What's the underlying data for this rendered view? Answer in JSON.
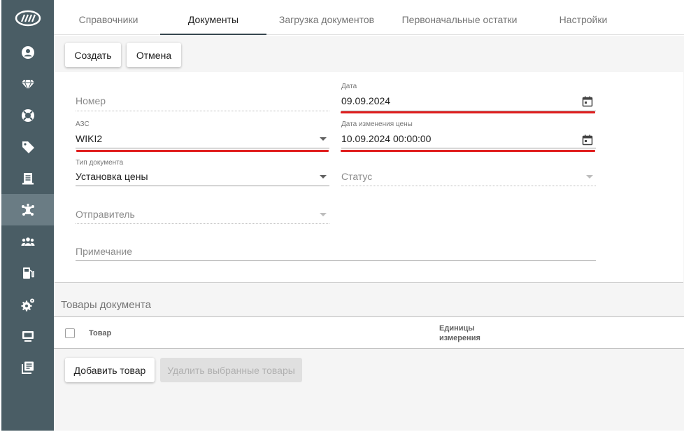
{
  "sidebar": {
    "logo_icon": "logo-ellipse-icon",
    "items": [
      {
        "icon": "user-icon"
      },
      {
        "icon": "diamond-icon"
      },
      {
        "icon": "lifebuoy-icon"
      },
      {
        "icon": "tag-icon"
      },
      {
        "icon": "receipt-icon"
      },
      {
        "icon": "network-icon",
        "active": true
      },
      {
        "icon": "group-icon"
      },
      {
        "icon": "fuel-pump-icon"
      },
      {
        "icon": "gears-icon"
      },
      {
        "icon": "monitor-icon"
      },
      {
        "icon": "library-icon"
      }
    ]
  },
  "tabs": [
    {
      "label": "Справочники"
    },
    {
      "label": "Документы",
      "active": true
    },
    {
      "label": "Загрузка документов"
    },
    {
      "label": "Первоначальные остатки"
    },
    {
      "label": "Настройки"
    }
  ],
  "toolbar": {
    "create_label": "Создать",
    "cancel_label": "Отмена"
  },
  "form": {
    "number": {
      "placeholder": "Номер"
    },
    "date": {
      "label": "Дата",
      "value": "09.09.2024"
    },
    "azs": {
      "label": "АЗС",
      "value": "WIKI2"
    },
    "price_change_date": {
      "label": "Дата изменения цены",
      "value": "10.09.2024 00:00:00"
    },
    "doc_type": {
      "label": "Тип документа",
      "value": "Установка цены"
    },
    "status": {
      "placeholder": "Статус"
    },
    "sender": {
      "placeholder": "Отправитель"
    },
    "note": {
      "placeholder": "Примечание"
    }
  },
  "goods": {
    "title": "Товары документа",
    "columns": {
      "product": "Товар",
      "units_line1": "Единицы",
      "units_line2": "измерения"
    },
    "add_label": "Добавить товар",
    "delete_label": "Удалить выбранные товары"
  },
  "colors": {
    "sidebar": "#4a5d65",
    "sidebar_active": "#6a7c84",
    "highlight": "#e01e1e"
  }
}
